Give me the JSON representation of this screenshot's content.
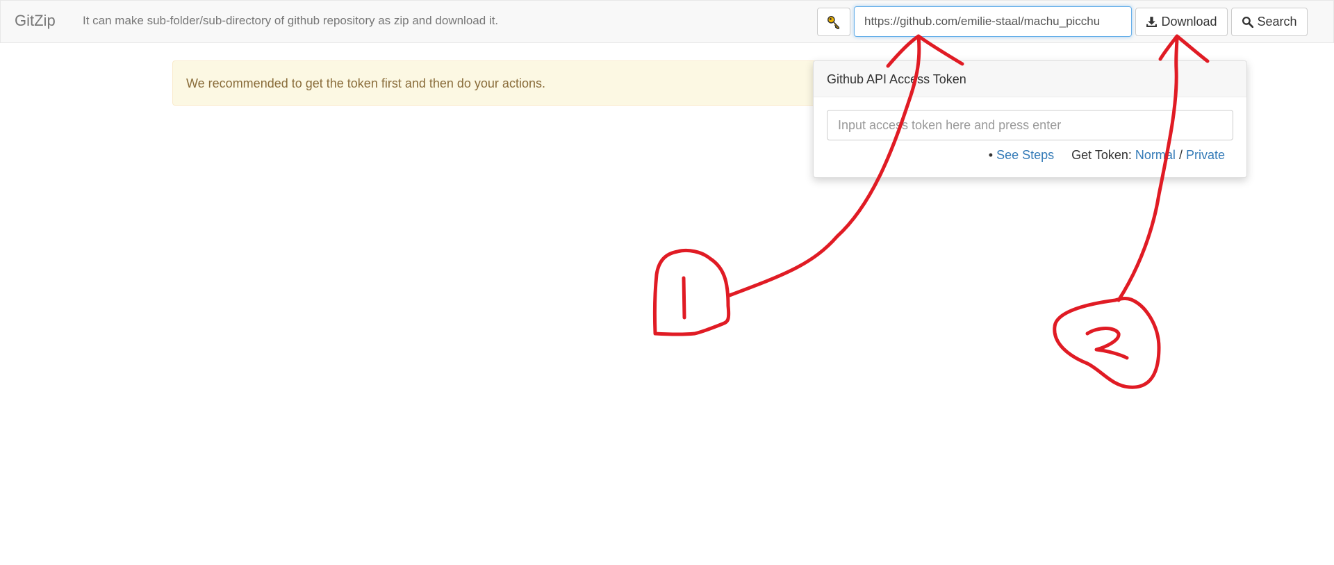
{
  "navbar": {
    "brand": "GitZip",
    "description": "It can make sub-folder/sub-directory of github repository as zip and download it.",
    "key_icon": "key-icon",
    "url_value": "https://github.com/emilie-staal/machu_picchu",
    "download_label": "Download",
    "download_icon": "download-icon",
    "search_label": "Search",
    "search_icon": "search-icon"
  },
  "alert": {
    "text": "We recommended to get the token first and then do your actions."
  },
  "token_popover": {
    "title": "Github API Access Token",
    "placeholder": "Input access token here and press enter",
    "bullet": "•",
    "see_steps": "See Steps",
    "get_token_label": "Get Token:",
    "normal_link": "Normal",
    "separator": "/",
    "private_link": "Private"
  },
  "colors": {
    "annotation": "#e01b24",
    "link": "#337ab7",
    "alert_bg": "#fcf8e3",
    "key_icon": "#f0b400"
  }
}
